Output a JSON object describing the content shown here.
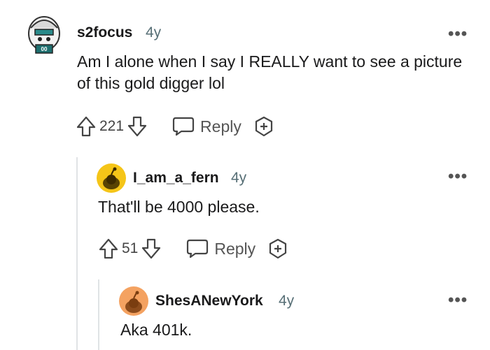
{
  "comments": [
    {
      "username": "s2focus",
      "age": "4y",
      "text": "Am I alone when I say I REALLY want to see a picture of this gold digger lol",
      "score": "221",
      "reply_label": "Reply",
      "more_label": "•••"
    },
    {
      "username": "I_am_a_fern",
      "age": "4y",
      "text": "That'll be 4000 please.",
      "score": "51",
      "reply_label": "Reply",
      "more_label": "•••"
    },
    {
      "username": "ShesANewYork",
      "age": "4y",
      "text": "Aka 401k.",
      "more_label": "•••"
    }
  ],
  "icons": {
    "upvote": "upvote-arrow-icon",
    "downvote": "downvote-arrow-icon",
    "reply": "speech-bubble-icon",
    "award": "award-plus-icon",
    "more": "ellipsis-icon"
  },
  "colors": {
    "text": "#1a1a1b",
    "meta": "#576f76",
    "thread_line": "#e0e3e5",
    "avatar_yellow": "#f5c518",
    "avatar_orange": "#f4a261"
  }
}
